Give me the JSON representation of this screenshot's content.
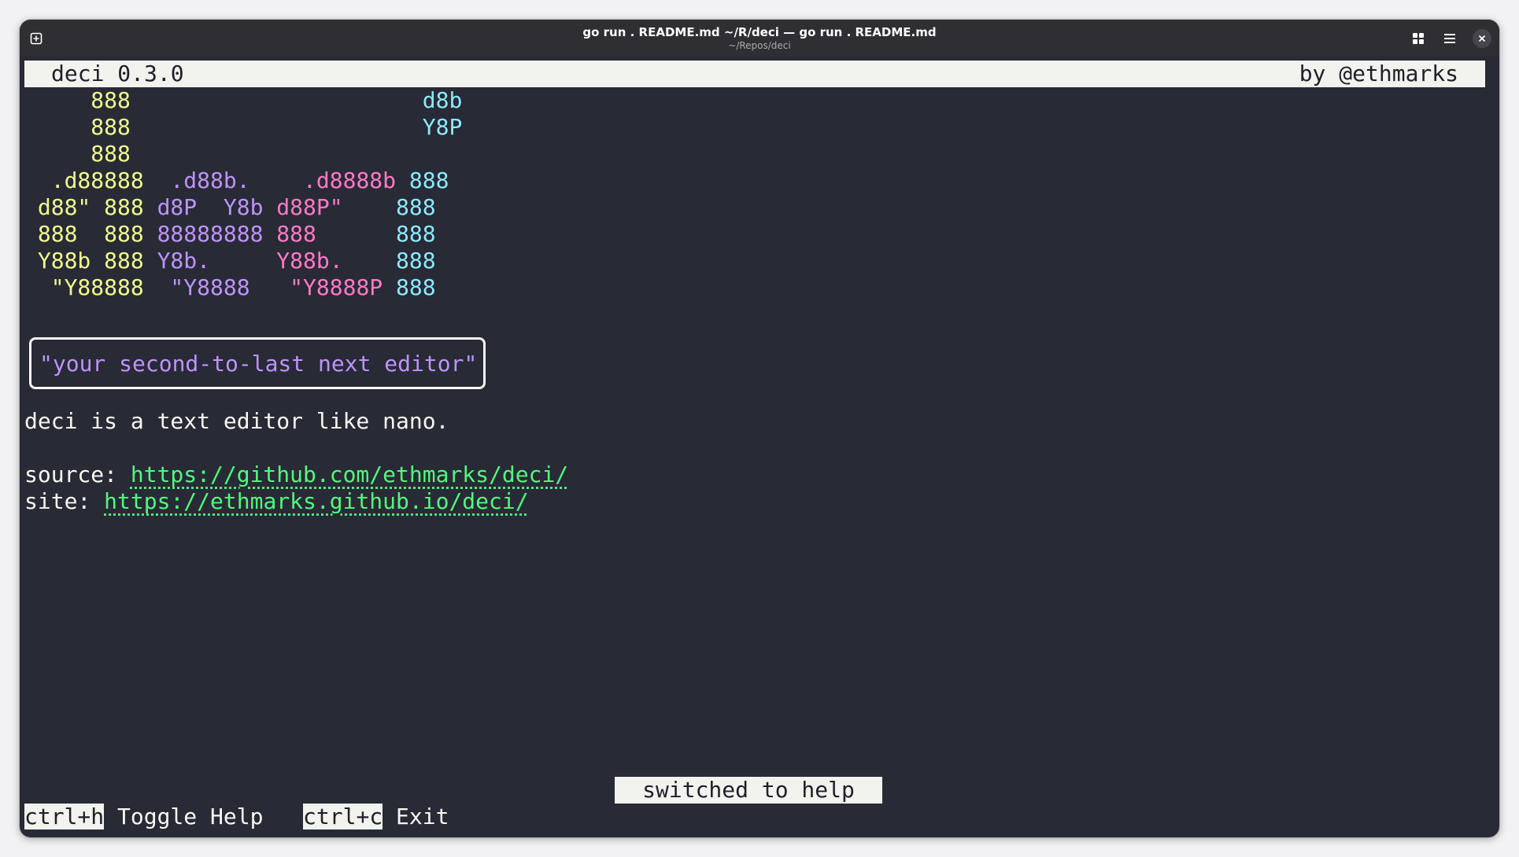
{
  "window": {
    "title": "go run . README.md ~/R/deci — go run . README.md",
    "subtitle": "~/Repos/deci",
    "icons": [
      "new-tab-icon",
      "grid-view-icon",
      "menu-icon",
      "close-icon"
    ]
  },
  "header": {
    "left": "deci 0.3.0",
    "right": "by @ethmarks"
  },
  "ascii_art": [
    {
      "yellow": "     888  ",
      "purple": "          ",
      "pink": "         ",
      "cyan": " d8b"
    },
    {
      "yellow": "     888  ",
      "purple": "          ",
      "pink": "         ",
      "cyan": " Y8P"
    },
    {
      "yellow": "     888  ",
      "purple": "          ",
      "pink": "         ",
      "cyan": ""
    },
    {
      "yellow": "  .d88888 ",
      "purple": " .d88b.   ",
      "pink": " .d8888b ",
      "cyan": "888"
    },
    {
      "yellow": " d88\" 888 ",
      "purple": "d8P  Y8b ",
      "pink": "d88P\"    ",
      "cyan": "888"
    },
    {
      "yellow": " 888  888 ",
      "purple": "88888888 ",
      "pink": "888      ",
      "cyan": "888"
    },
    {
      "yellow": " Y88b 888 ",
      "purple": "Y8b.     ",
      "pink": "Y88b.    ",
      "cyan": "888"
    },
    {
      "yellow": "  \"Y88888 ",
      "purple": " \"Y8888  ",
      "pink": " \"Y8888P ",
      "cyan": "888"
    }
  ],
  "tagline": "\"your second-to-last next editor\"",
  "description": "deci is a text editor like nano.",
  "links": {
    "source_label": "source: ",
    "source_url": "https://github.com/ethmarks/deci/",
    "site_label": "site: ",
    "site_url": "https://ethmarks.github.io/deci/"
  },
  "status_message": "switched to help",
  "shortcuts": [
    {
      "key": "ctrl+h",
      "label": "Toggle Help"
    },
    {
      "key": "ctrl+c",
      "label": "Exit"
    }
  ],
  "colors": {
    "background": "#282a36",
    "foreground": "#f8f8f2",
    "yellow": "#f1fa8c",
    "purple": "#bd93f9",
    "pink": "#ff79c6",
    "cyan": "#8be9fd",
    "green": "#50fa7b"
  }
}
